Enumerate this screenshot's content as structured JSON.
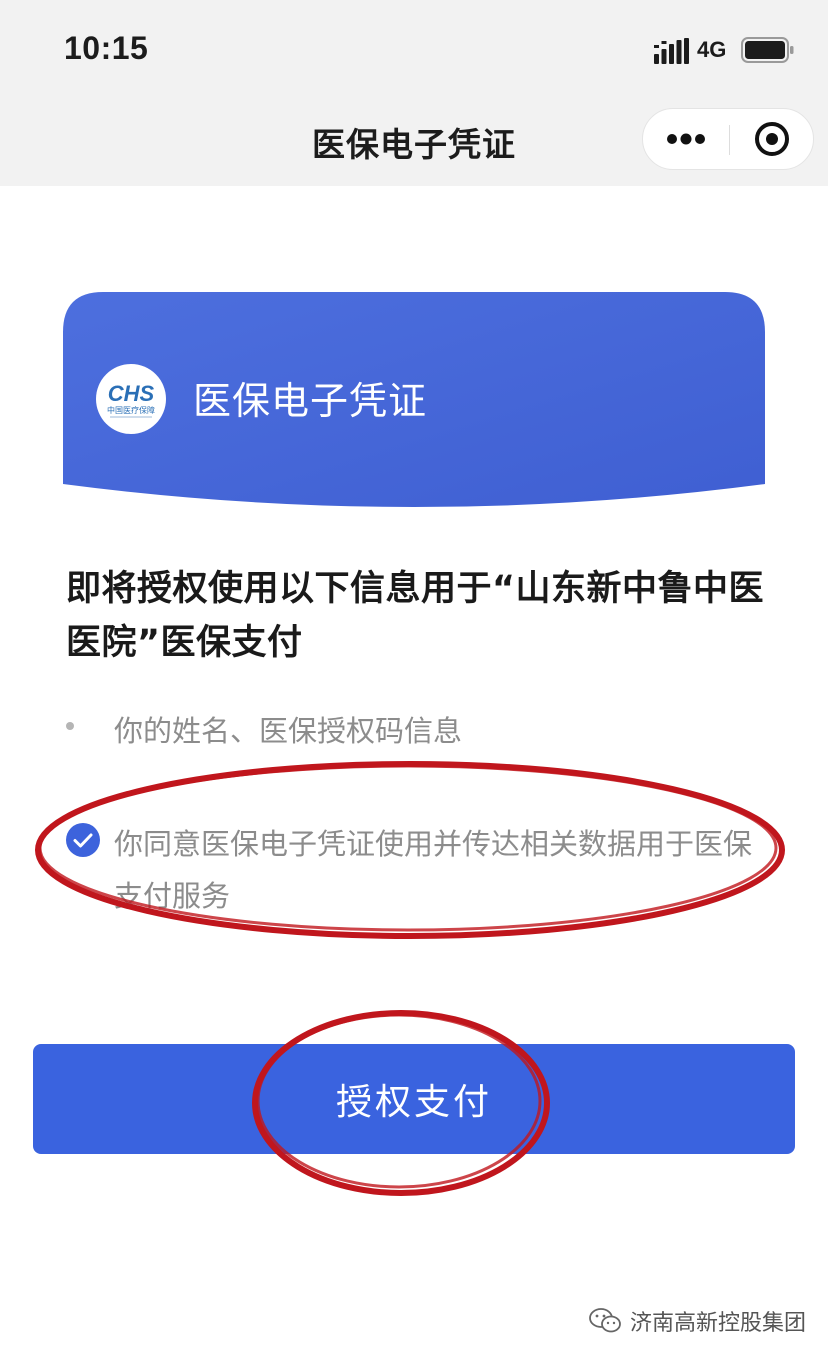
{
  "status_bar": {
    "time": "10:15",
    "network": "4G",
    "signal_icon": "signal-bars-icon",
    "battery_icon": "battery-icon"
  },
  "nav": {
    "title": "医保电子凭证",
    "more_icon": "more-dots-icon",
    "close_icon": "target-close-icon"
  },
  "card": {
    "logo_text": "CHS",
    "logo_subtext": "中国医疗保障",
    "title": "医保电子凭证",
    "color": "#4566d9"
  },
  "authorization": {
    "heading": "即将授权使用以下信息用于“山东新中鲁中医医院”医保支付",
    "info_items": [
      {
        "text": "你的姓名、医保授权码信息"
      }
    ],
    "consent_text": "你同意医保电子凭证使用并传达相关数据用于医保支付服务",
    "consent_checked": true
  },
  "button": {
    "label": "授权支付",
    "color": "#3a63df"
  },
  "annotation": {
    "color": "#c0161d"
  },
  "watermark": {
    "text": "济南高新控股集团",
    "icon": "wechat-icon"
  }
}
